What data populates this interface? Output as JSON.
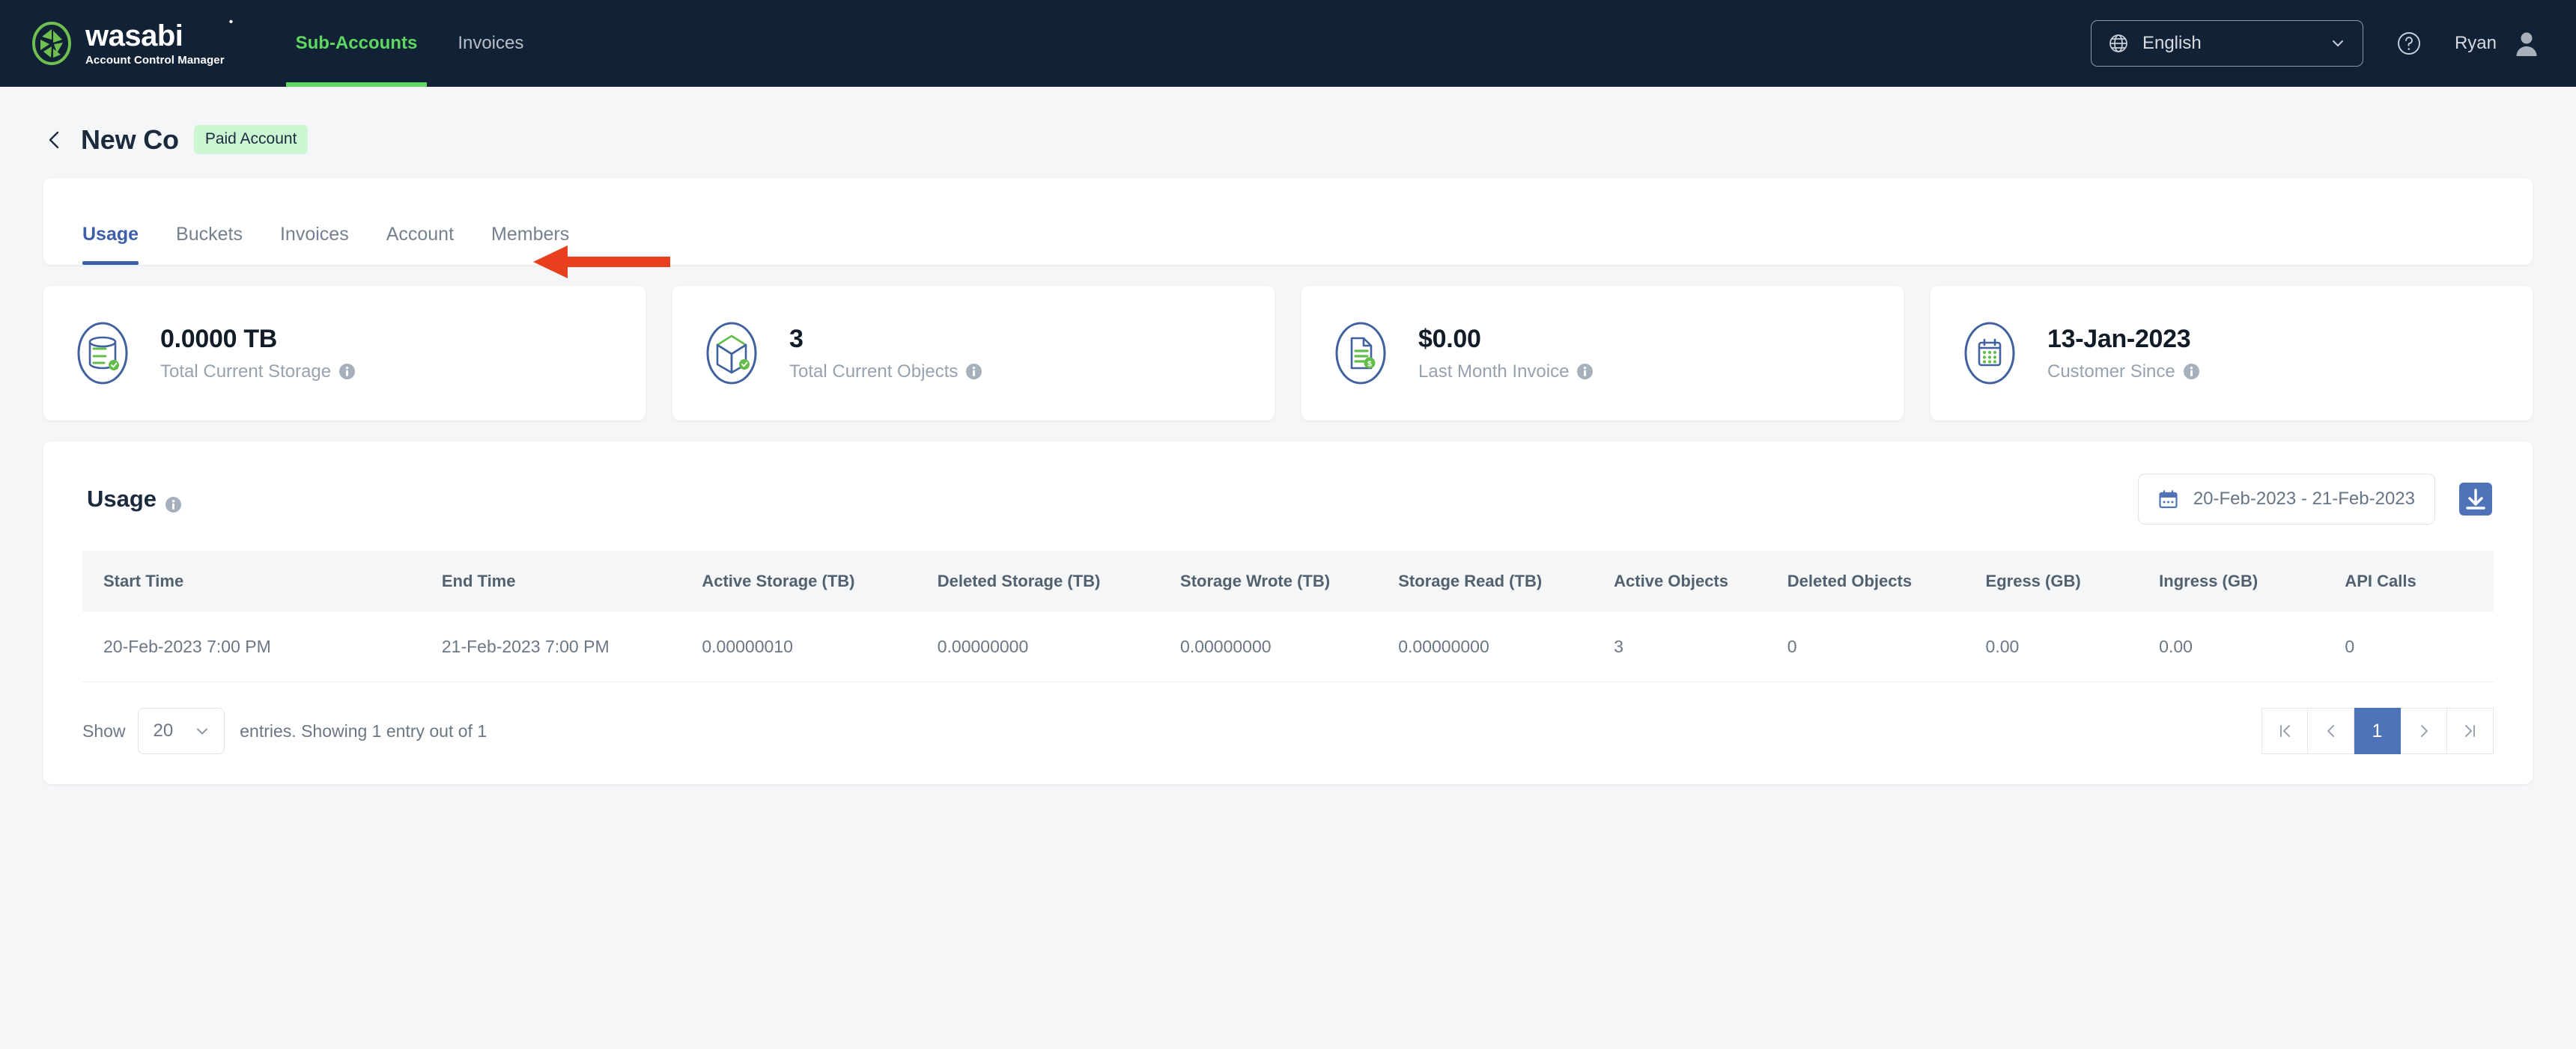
{
  "topnav": {
    "brand": {
      "word": "wasabi",
      "tagline": "Account Control Manager",
      "logo_icon": "wasabi-leaf-logo"
    },
    "items": [
      {
        "label": "Sub-Accounts",
        "active": true
      },
      {
        "label": "Invoices",
        "active": false
      }
    ],
    "language": {
      "icon": "globe-icon",
      "value": "English",
      "chevron": "chevron-down-icon"
    },
    "help_icon": "help-circle-icon",
    "user": {
      "name": "Ryan",
      "avatar_icon": "user-avatar-icon"
    },
    "bg_color": "#112236",
    "accent_color": "#5ed860"
  },
  "page": {
    "back_icon": "chevron-left-icon",
    "title": "New Co",
    "badge": "Paid Account",
    "badge_bg": "#cdf7d3"
  },
  "tabs": [
    {
      "label": "Usage",
      "active": true
    },
    {
      "label": "Buckets",
      "active": false
    },
    {
      "label": "Invoices",
      "active": false
    },
    {
      "label": "Account",
      "active": false
    },
    {
      "label": "Members",
      "active": false
    }
  ],
  "annotation": {
    "shape": "left-arrow",
    "color": "#e8401f",
    "points_at": "Account"
  },
  "stats": [
    {
      "icon": "database-storage-icon",
      "value": "0.0000 TB",
      "label": "Total Current Storage",
      "info_icon": "info-icon"
    },
    {
      "icon": "cube-objects-icon",
      "value": "3",
      "label": "Total Current Objects",
      "info_icon": "info-icon"
    },
    {
      "icon": "invoice-dollar-icon",
      "value": "$0.00",
      "label": "Last Month Invoice",
      "info_icon": "info-icon"
    },
    {
      "icon": "calendar-icon",
      "value": "13-Jan-2023",
      "label": "Customer Since",
      "info_icon": "info-icon"
    }
  ],
  "usage": {
    "title": "Usage",
    "info_icon": "info-icon",
    "date_range": {
      "icon": "calendar-icon",
      "value": "20-Feb-2023 - 21-Feb-2023"
    },
    "download_button": {
      "icon": "download-icon",
      "color": "#4e73b8"
    }
  },
  "table": {
    "columns": [
      "Start Time",
      "End Time",
      "Active Storage (TB)",
      "Deleted Storage (TB)",
      "Storage Wrote (TB)",
      "Storage Read (TB)",
      "Active Objects",
      "Deleted Objects",
      "Egress (GB)",
      "Ingress (GB)",
      "API Calls"
    ],
    "rows": [
      [
        "20-Feb-2023 7:00 PM",
        "21-Feb-2023 7:00 PM",
        "0.00000010",
        "0.00000000",
        "0.00000000",
        "0.00000000",
        "3",
        "0",
        "0.00",
        "0.00",
        "0"
      ]
    ]
  },
  "footer": {
    "show_label": "Show",
    "page_size": "20",
    "chevron": "chevron-down-icon",
    "entries_text": "entries. Showing 1 entry out of 1",
    "pagination": {
      "first_icon": "first-page-icon",
      "prev_icon": "prev-page-icon",
      "current_page": "1",
      "next_icon": "next-page-icon",
      "last_icon": "last-page-icon",
      "active_color": "#4e73b8"
    }
  }
}
